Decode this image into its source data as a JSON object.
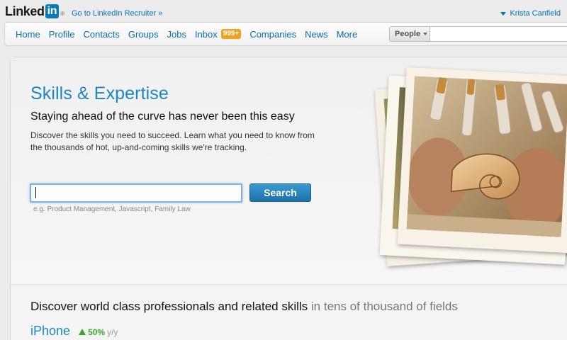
{
  "app": {
    "logo_text": "Linked",
    "logo_box_text": "in",
    "logo_mark": "®",
    "recruiter_link": "Go to LinkedIn Recruiter »",
    "user_name": "Krista Canfield"
  },
  "nav": {
    "items": [
      {
        "label": "Home"
      },
      {
        "label": "Profile"
      },
      {
        "label": "Contacts"
      },
      {
        "label": "Groups"
      },
      {
        "label": "Jobs"
      },
      {
        "label": "Inbox",
        "badge": "999+"
      },
      {
        "label": "Companies"
      },
      {
        "label": "News"
      },
      {
        "label": "More"
      }
    ],
    "search_scope": "People",
    "search_value": ""
  },
  "hero": {
    "title": "Skills & Expertise",
    "subtitle": "Staying ahead of the curve has never been this easy",
    "description": "Discover the skills you need to succeed. Learn what you need to know from the thousands of hot, up-and-coming skills we're tracking.",
    "search_value": "",
    "search_button": "Search",
    "search_hint": "e.g. Product Management, Javascript, Family Law",
    "photo_subject": "hands carving a violin scroll with chisels"
  },
  "discover": {
    "title": "Discover world class professionals and related skills",
    "title_muted": "in tens of thousand of fields",
    "featured_skill": {
      "name": "iPhone",
      "trend": "50%",
      "trend_unit": "y/y",
      "trend_direction": "up"
    }
  },
  "colors": {
    "brand_blue": "#1e87be",
    "link_blue": "#0a6fb0",
    "badge_orange": "#f0a21c",
    "trend_green": "#3ca533",
    "button_blue": "#1b72a8"
  }
}
